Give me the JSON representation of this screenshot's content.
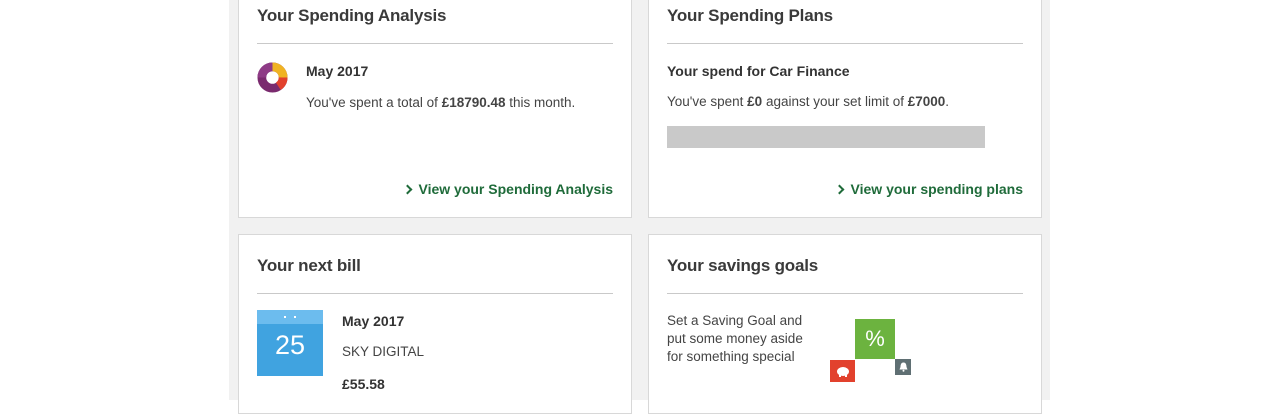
{
  "analysis": {
    "title": "Your Spending Analysis",
    "period": "May 2017",
    "text_prefix": "You've spent a total of ",
    "amount": "£18790.48",
    "text_suffix": " this month.",
    "link": "View your Spending Analysis",
    "icon": "donut-chart-icon"
  },
  "plans": {
    "title": "Your Spending Plans",
    "heading": "Your spend for Car Finance",
    "text_prefix": "You've spent ",
    "spent": "£0",
    "text_middle": " against your set limit of ",
    "limit": "£7000",
    "text_suffix": ".",
    "progress": 0,
    "link": "View your spending plans"
  },
  "bill": {
    "title": "Your next bill",
    "day": "25",
    "period": "May 2017",
    "payee": "SKY DIGITAL",
    "amount": "£55.58",
    "icon": "calendar-icon"
  },
  "savings": {
    "title": "Your savings goals",
    "description": "Set a Saving Goal and put some money aside for something special",
    "percent_symbol": "%",
    "icons": [
      "percent-icon",
      "piggy-bank-icon",
      "bell-icon"
    ]
  },
  "colors": {
    "link_green": "#1f6b3a",
    "calendar_blue": "#40a3e0",
    "savings_green": "#6cb33f",
    "savings_red": "#e2412d",
    "savings_gray": "#5f6f73"
  }
}
